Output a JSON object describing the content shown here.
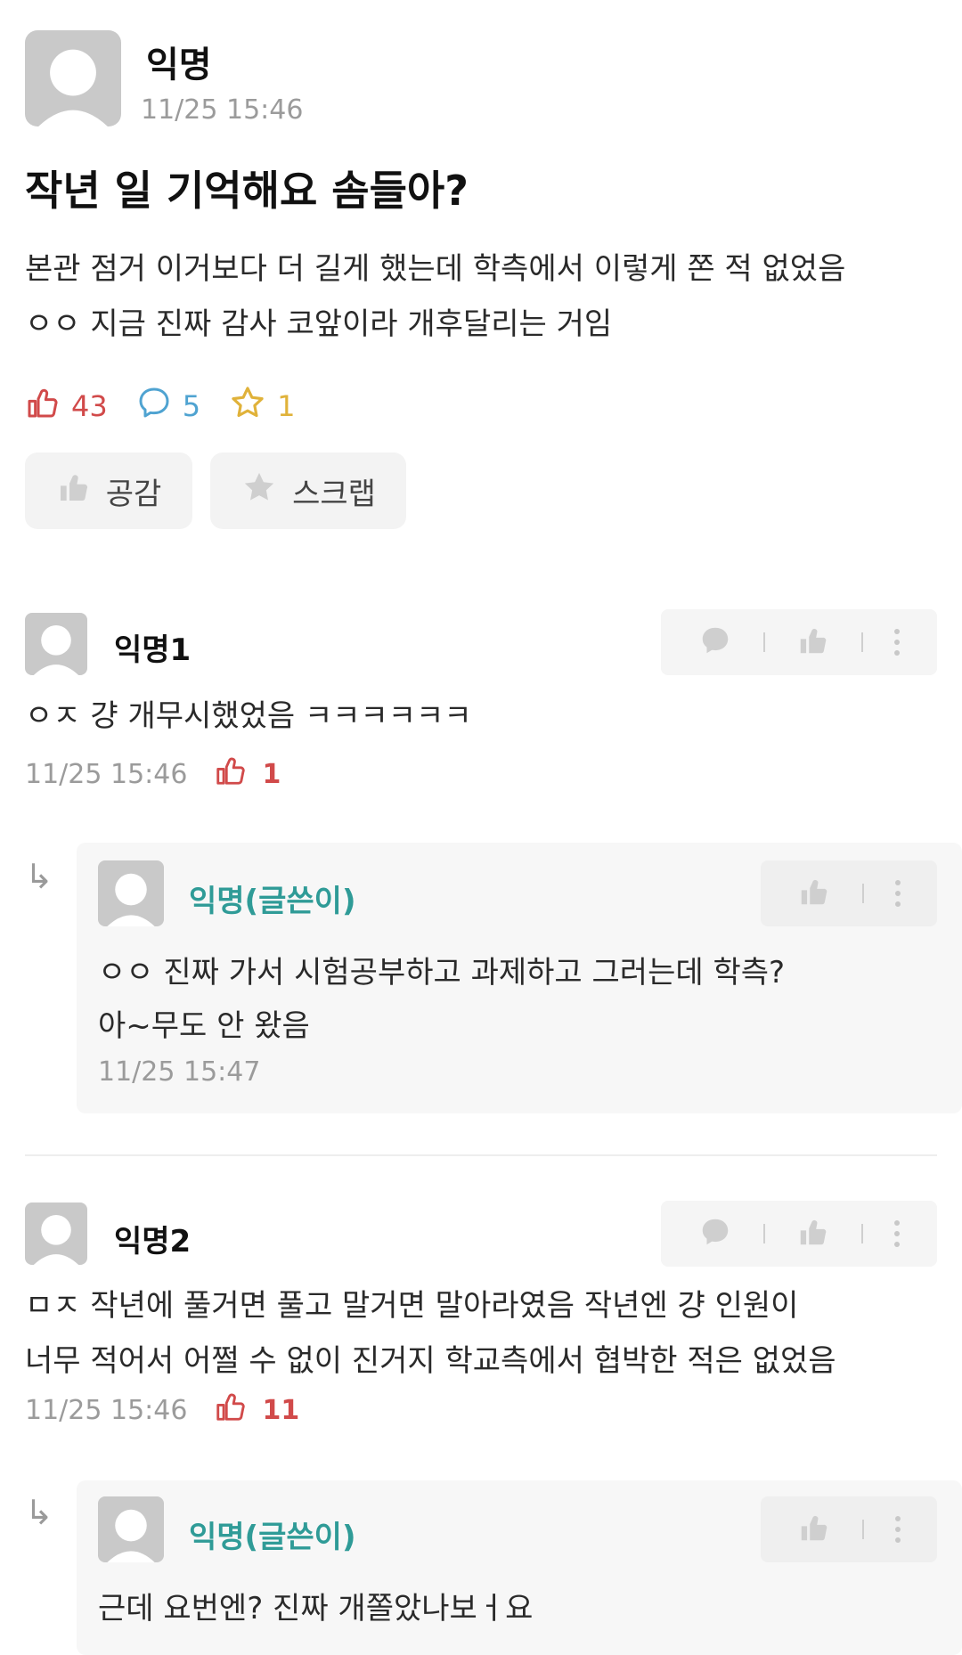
{
  "post": {
    "author": "익명",
    "time": "11/25 15:46",
    "title": "작년 일 기억해요 솜들아?",
    "body_line1": "본관 점거 이거보다 더 길게 했는데 학측에서 이렇게 쫀 적 없었음",
    "body_line2": "ㅇㅇ 지금 진짜 감사 코앞이라 개후달리는 거임",
    "likes": "43",
    "comments": "5",
    "scraps": "1",
    "like_button": "공감",
    "scrap_button": "스크랩"
  },
  "comments": [
    {
      "author": "익명1",
      "text": "ㅇㅈ 걍 개무시했었음 ㅋㅋㅋㅋㅋㅋ",
      "time": "11/25 15:46",
      "likes": "1",
      "reply": {
        "author": "익명(글쓴이)",
        "line1": "ㅇㅇ 진짜 가서 시험공부하고 과제하고 그러는데 학측?",
        "line2": "아~무도 안 왔음",
        "time": "11/25 15:47"
      }
    },
    {
      "author": "익명2",
      "line1": "ㅁㅈ 작년에 풀거면 풀고 말거면 말아라였음 작년엔 걍 인원이",
      "line2": "너무 적어서 어쩔 수 없이 진거지 학교측에서 협박한 적은 없었음",
      "time": "11/25 15:46",
      "likes": "11",
      "reply": {
        "author": "익명(글쓴이)",
        "line1": "근데 요번엔? 진짜 개쫄았나보ㅓ요"
      }
    }
  ],
  "colors": {
    "like": "#d14a4a",
    "comment": "#4fa3d1",
    "scrap": "#e0b23a",
    "writer": "#2f9b97"
  }
}
